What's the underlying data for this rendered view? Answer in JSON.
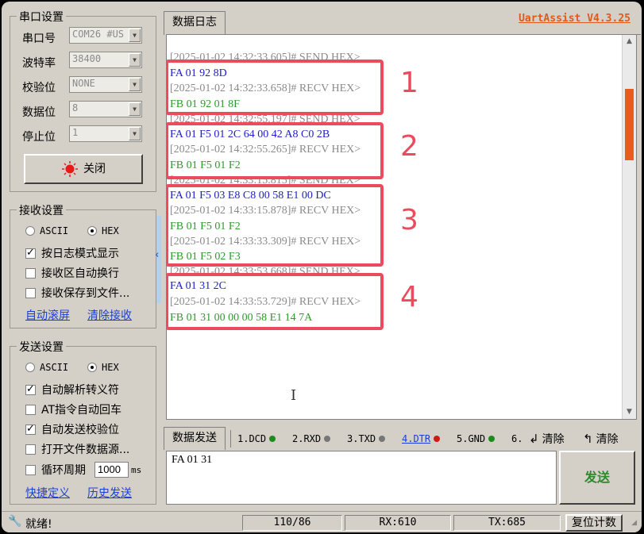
{
  "app": {
    "title": "UartAssist V4.3.25"
  },
  "serial": {
    "group_title": "串口设置",
    "port_label": "串口号",
    "port_value": "COM26 #US",
    "baud_label": "波特率",
    "baud_value": "38400",
    "parity_label": "校验位",
    "parity_value": "NONE",
    "databits_label": "数据位",
    "databits_value": "8",
    "stopbits_label": "停止位",
    "stopbits_value": "1",
    "toggle_button": "关闭"
  },
  "receive": {
    "group_title": "接收设置",
    "ascii": "ASCII",
    "hex": "HEX",
    "opt_log_mode": "按日志模式显示",
    "opt_auto_wrap": "接收区自动换行",
    "opt_save_file": "接收保存到文件...",
    "link_auto_scroll": "自动滚屏",
    "link_clear": "清除接收"
  },
  "send": {
    "group_title": "发送设置",
    "ascii": "ASCII",
    "hex": "HEX",
    "opt_escape": "自动解析转义符",
    "opt_at_cr": "AT指令自动回车",
    "opt_checksum": "自动发送校验位",
    "opt_file_source": "打开文件数据源...",
    "opt_cycle": "循环周期",
    "cycle_value": "1000",
    "cycle_unit": "ms",
    "link_shortcuts": "快捷定义",
    "link_history": "历史发送"
  },
  "log": {
    "tab": "数据日志",
    "lines": [
      "[2025-01-02 14:32:33.605]# SEND HEX>",
      "FA 01 92 8D",
      "[2025-01-02 14:32:33.658]# RECV HEX>",
      "FB 01 92 01 8F",
      "[2025-01-02 14:32:55.197]# SEND HEX>",
      "FA 01 F5 01 2C 64 00 42 A8 C0 2B",
      "[2025-01-02 14:32:55.265]# RECV HEX>",
      "FB 01 F5 01 F2",
      "[2025-01-02 14:33:15.815]# SEND HEX>",
      "FA 01 F5 03 E8 C8 00 58 E1 00 DC",
      "[2025-01-02 14:33:15.878]# RECV HEX>",
      "FB 01 F5 01 F2",
      "[2025-01-02 14:33:33.309]# RECV HEX>",
      "FB 01 F5 02 F3",
      "[2025-01-02 14:33:53.668]# SEND HEX>",
      "FA 01 31 2C",
      "[2025-01-02 14:33:53.729]# RECV HEX>",
      "FB 01 31 00 00 00 58 E1 14 7A"
    ],
    "annotations": [
      "1",
      "2",
      "3",
      "4"
    ]
  },
  "sendpanel": {
    "tab": "数据发送",
    "signals": [
      "1.DCD",
      "2.RXD",
      "3.TXD",
      "4.DTR",
      "5.GND",
      "6."
    ],
    "clear1": "清除",
    "clear2": "清除",
    "input": "FA 01 31",
    "send_button": "发送"
  },
  "status": {
    "ready": "就绪!",
    "count": "110/86",
    "rx": "RX:610",
    "tx": "TX:685",
    "reset": "复位计数"
  },
  "colors": {
    "accent": "#e05a1c",
    "annotation": "#ea4c5e",
    "send_text": "#2020c8",
    "recv_text": "#2c9b2c"
  }
}
